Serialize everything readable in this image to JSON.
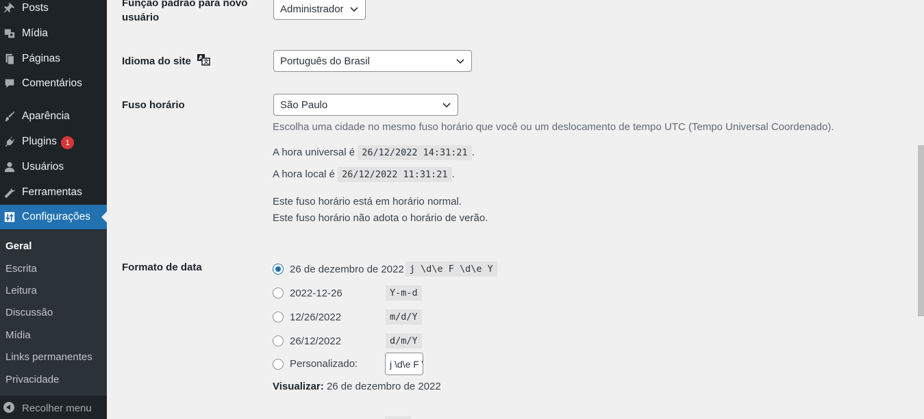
{
  "sidebar": {
    "items": [
      {
        "label": "Posts",
        "icon": "pin-icon"
      },
      {
        "label": "Mídia",
        "icon": "media-icon"
      },
      {
        "label": "Páginas",
        "icon": "pages-icon"
      },
      {
        "label": "Comentários",
        "icon": "comments-icon"
      },
      {
        "label": "Aparência",
        "icon": "paintbrush-icon"
      },
      {
        "label": "Plugins",
        "icon": "plugin-icon",
        "badge": "1"
      },
      {
        "label": "Usuários",
        "icon": "user-icon"
      },
      {
        "label": "Ferramentas",
        "icon": "wrench-icon"
      },
      {
        "label": "Configurações",
        "icon": "settings-icon",
        "active": true
      }
    ],
    "submenu": [
      "Geral",
      "Escrita",
      "Leitura",
      "Discussão",
      "Mídia",
      "Links permanentes",
      "Privacidade"
    ],
    "collapse_label": "Recolher menu"
  },
  "settings": {
    "default_role": {
      "label": "Função padrão para novo usuário",
      "value": "Administrador"
    },
    "site_language": {
      "label": "Idioma do site",
      "value": "Português do Brasil"
    },
    "timezone": {
      "label": "Fuso horário",
      "value": "São Paulo",
      "description": "Escolha uma cidade no mesmo fuso horário que você ou um deslocamento de tempo UTC (Tempo Universal Coordenado).",
      "utc_prefix": "A hora universal é",
      "utc_time": "26/12/2022 14:31:21",
      "local_prefix": "A hora local é",
      "local_time": "26/12/2022 11:31:21",
      "note1": "Este fuso horário está em horário normal.",
      "note2": "Este fuso horário não adota o horário de verão."
    },
    "date_format": {
      "label": "Formato de data",
      "options": [
        {
          "label": "26 de dezembro de 2022",
          "code": "j \\d\\e F \\d\\e Y",
          "checked": true
        },
        {
          "label": "2022-12-26",
          "code": "Y-m-d"
        },
        {
          "label": "12/26/2022",
          "code": "m/d/Y"
        },
        {
          "label": "26/12/2022",
          "code": "d/m/Y"
        },
        {
          "label": "Personalizado:",
          "code": ""
        }
      ],
      "custom_value": "j \\d\\e F \\d\\e Y",
      "preview_label": "Visualizar:",
      "preview_value": "26 de dezembro de 2022"
    }
  },
  "colors": {
    "accent": "#2271b1",
    "sidebar_bg": "#1d2327",
    "badge": "#d63638"
  }
}
